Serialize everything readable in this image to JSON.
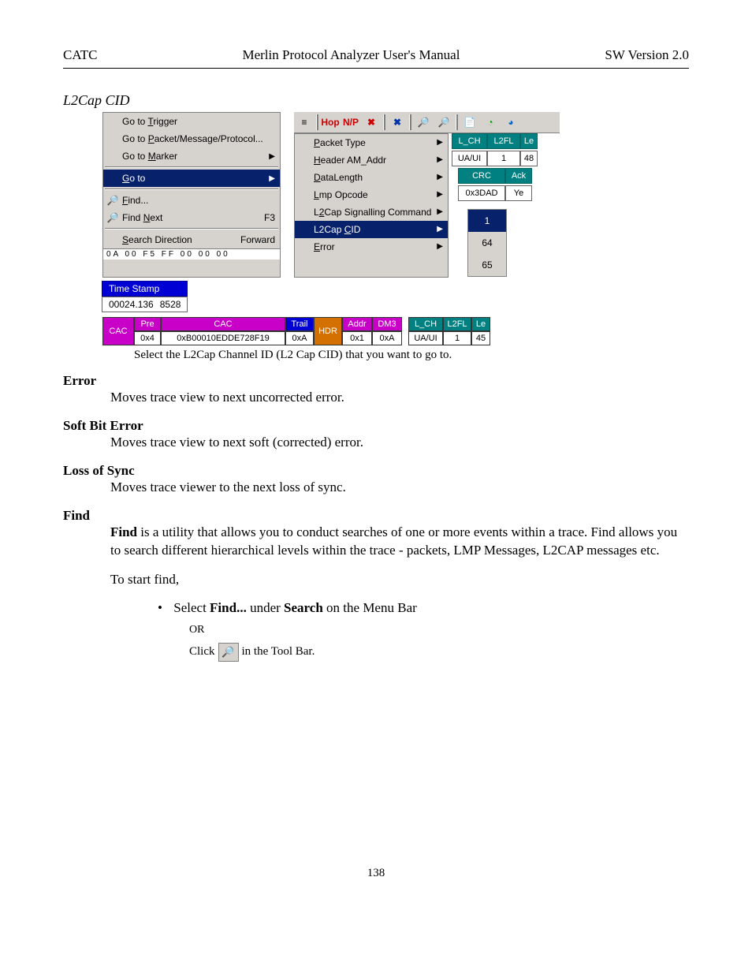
{
  "header": {
    "left": "CATC",
    "center": "Merlin Protocol Analyzer User's Manual",
    "right": "SW Version 2.0"
  },
  "section_title": "L2Cap CID",
  "menu1": {
    "i0": "Go to Trigger",
    "i1": "Go to Packet/Message/Protocol...",
    "i2": "Go to Marker",
    "i3": "Go to",
    "i4": "Find...",
    "i5": "Find Next",
    "i5s": "F3",
    "i6l": "Search Direction",
    "i6r": "Forward"
  },
  "hexrow": "0A    00    F5    FF    00    00    00",
  "submenu": {
    "s0": "Packet Type",
    "s1": "Header AM_Addr",
    "s2": "DataLength",
    "s3": "Lmp Opcode",
    "s4": "L2Cap Signalling Command",
    "s5": "L2Cap CID",
    "s6": "Error"
  },
  "rightcells": {
    "r0a": "L_CH",
    "r0b": "L2FL",
    "r0c": "Le",
    "r1a": "UA/UI",
    "r1b": "1",
    "r1c": "48",
    "r2a": "CRC",
    "r2b": "Ack",
    "r3a": "0x3DAD",
    "r3b": "Ye"
  },
  "valmenu": {
    "v0": "1",
    "v1": "64",
    "v2": "65"
  },
  "ts": {
    "label": "Time Stamp",
    "val1": "00024.136",
    "val2": "8528"
  },
  "pbar": {
    "c0": "CAC",
    "c1t": "Pre",
    "c1b": "0x4",
    "c2t": "CAC",
    "c2b": "0xB00010EDDE728F19",
    "c3t": "Trail",
    "c3b": "0xA",
    "c4": "HDR",
    "c5t": "Addr",
    "c5b": "0x1",
    "c6t": "DM3",
    "c6b": "0xA",
    "c7t": "L_CH",
    "c7b": "UA/UI",
    "c8t": "L2FL",
    "c8b": "1",
    "c9t": "Le",
    "c9b": "45"
  },
  "caption": "Select the L2Cap Channel ID (L2 Cap CID) that you want to go to.",
  "sec_error": {
    "h": "Error",
    "b": "Moves trace view to next uncorrected error."
  },
  "sec_soft": {
    "h": "Soft Bit Error",
    "b": "Moves trace view to next soft (corrected) error."
  },
  "sec_loss": {
    "h": "Loss of Sync",
    "b": "Moves trace viewer to the next loss of sync."
  },
  "sec_find": {
    "h": "Find",
    "b1a": "Find",
    "b1b": " is a utility that allows you to conduct searches of one or more events within a trace.  Find allows you to search different hierarchical levels within the trace - packets, LMP Messages, L2CAP messages etc.",
    "b2": "To start find,",
    "bul_pre": "Select ",
    "bul_find": "Find...",
    "bul_mid": " under ",
    "bul_search": "Search",
    "bul_post": " on the Menu Bar",
    "or": "OR",
    "click_pre": "Click ",
    "click_post": " in the Tool Bar."
  },
  "pagenum": "138"
}
